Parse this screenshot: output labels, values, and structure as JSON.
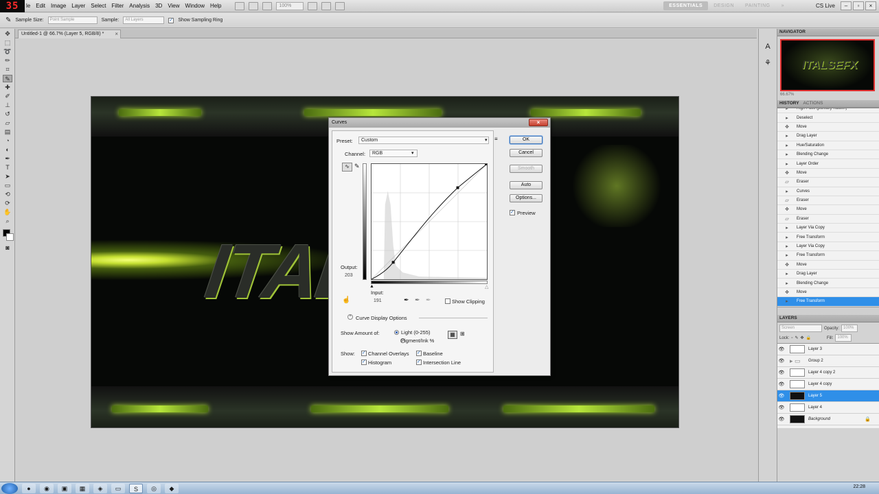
{
  "app": {
    "logo": "35"
  },
  "menu": [
    "le",
    "Edit",
    "Image",
    "Layer",
    "Select",
    "Filter",
    "Analysis",
    "3D",
    "View",
    "Window",
    "Help"
  ],
  "menubar": {
    "zoom": "100%",
    "workspaces": [
      "ESSENTIALS",
      "DESIGN",
      "PAINTING"
    ],
    "more": "»",
    "cslive": "CS Live"
  },
  "options": {
    "sample_size_label": "Sample Size:",
    "sample_size_value": "Point Sample",
    "sample_label": "Sample:",
    "sample_value": "All Layers",
    "show_ring_label": "Show Sampling Ring"
  },
  "document": {
    "tab_title": "Untitled-1 @ 66.7% (Layer 5, RGB/8) *",
    "close": "×"
  },
  "artwork": {
    "text": "ITAL   X"
  },
  "curves": {
    "title": "Curves",
    "preset_label": "Preset:",
    "preset_value": "Custom",
    "channel_label": "Channel:",
    "channel_value": "RGB",
    "output_label": "Output:",
    "output_value": "203",
    "input_label": "Input:",
    "input_value": "191",
    "show_clipping": "Show Clipping",
    "display_options": "Curve Display Options",
    "show_amount_label": "Show Amount of:",
    "light_option": "Light  (0-255)",
    "pigment_option": "Pigment/Ink %",
    "show_label": "Show:",
    "channel_overlays": "Channel Overlays",
    "baseline": "Baseline",
    "histogram": "Histogram",
    "intersection_line": "Intersection Line",
    "ok": "OK",
    "cancel": "Cancel",
    "smooth": "Smooth",
    "auto": "Auto",
    "options": "Options...",
    "preview": "Preview"
  },
  "navigator": {
    "tab": "NAVIGATOR",
    "thumb_text": "ITALSEFX",
    "zoom": "66.67%"
  },
  "history": {
    "tabs": [
      "HISTORY",
      "ACTIONS"
    ],
    "items": [
      {
        "label": "High Pass (partially hidden)",
        "icon": "filter"
      },
      {
        "label": "Deselect",
        "icon": "step"
      },
      {
        "label": "Move",
        "icon": "move"
      },
      {
        "label": "Drag Layer",
        "icon": "step"
      },
      {
        "label": "Hue/Saturation",
        "icon": "step"
      },
      {
        "label": "Blending Change",
        "icon": "step"
      },
      {
        "label": "Layer Order",
        "icon": "step"
      },
      {
        "label": "Move",
        "icon": "move"
      },
      {
        "label": "Eraser",
        "icon": "eraser"
      },
      {
        "label": "Curves",
        "icon": "step"
      },
      {
        "label": "Eraser",
        "icon": "eraser"
      },
      {
        "label": "Move",
        "icon": "move"
      },
      {
        "label": "Eraser",
        "icon": "eraser"
      },
      {
        "label": "Layer Via Copy",
        "icon": "step"
      },
      {
        "label": "Free Transform",
        "icon": "step"
      },
      {
        "label": "Layer Via Copy",
        "icon": "step"
      },
      {
        "label": "Free Transform",
        "icon": "step"
      },
      {
        "label": "Move",
        "icon": "move"
      },
      {
        "label": "Drag Layer",
        "icon": "step"
      },
      {
        "label": "Blending Change",
        "icon": "step"
      },
      {
        "label": "Move",
        "icon": "move"
      },
      {
        "label": "Free Transform",
        "icon": "step"
      }
    ]
  },
  "layers": {
    "tab": "LAYERS",
    "blend_mode": "Screen",
    "opacity_label": "Opacity:",
    "opacity_value": "100%",
    "lock_label": "Lock:",
    "fill_label": "Fill:",
    "fill_value": "100%",
    "items": [
      {
        "name": "Layer 3",
        "thumb": "light"
      },
      {
        "name": "Group 2",
        "thumb": "folder"
      },
      {
        "name": "Layer 4 copy 2",
        "thumb": "light"
      },
      {
        "name": "Layer 4 copy",
        "thumb": "light"
      },
      {
        "name": "Layer 5",
        "thumb": "dark"
      },
      {
        "name": "Layer 4",
        "thumb": "light"
      },
      {
        "name": "Background",
        "thumb": "dark"
      }
    ]
  },
  "taskbar": {
    "clock": "22:28"
  },
  "colors": {
    "accent": "#2f8fe8",
    "glow": "#b7e63b"
  }
}
